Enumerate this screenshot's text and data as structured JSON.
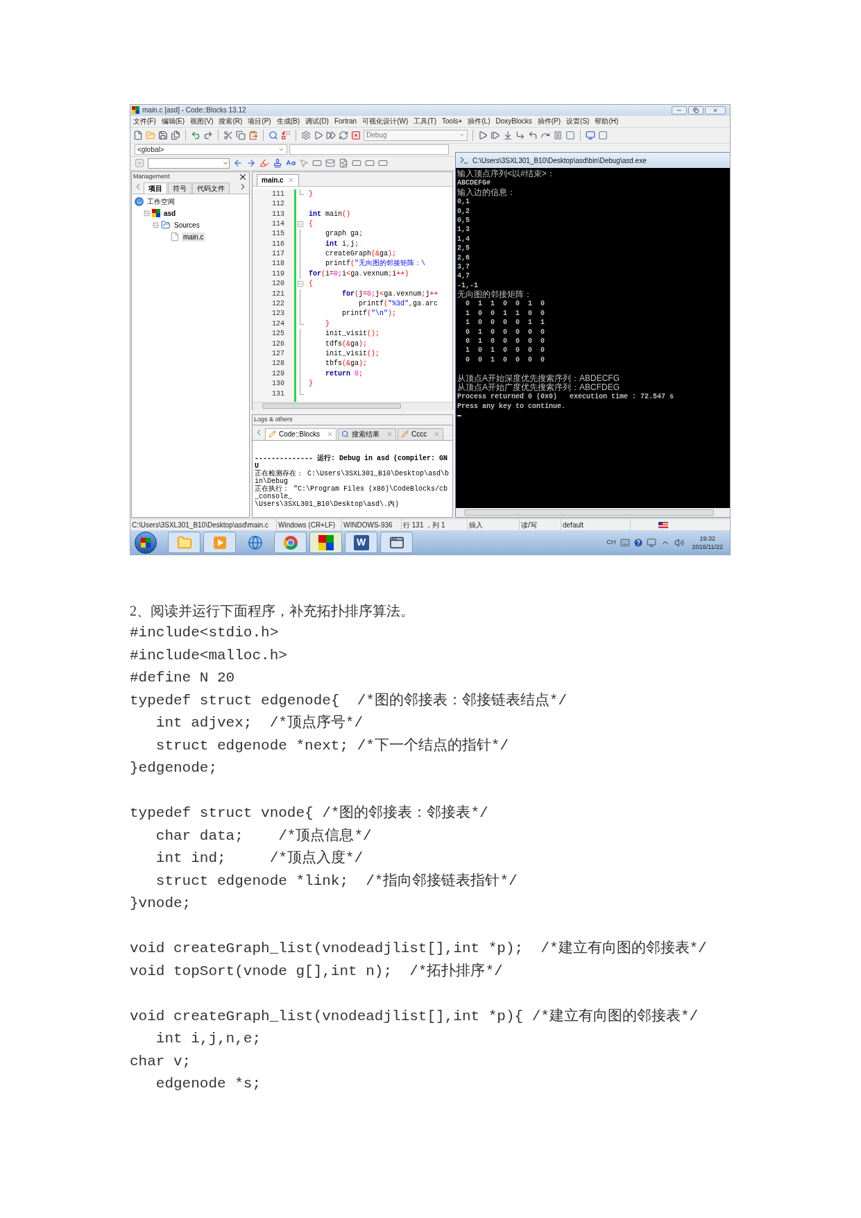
{
  "ide": {
    "title": "main.c [asd] - Code::Blocks 13.12",
    "menu": [
      "文件(F)",
      "编辑(E)",
      "视图(V)",
      "搜索(R)",
      "项目(P)",
      "生成(B)",
      "调试(D)",
      "Fortran",
      "可视化设计(W)",
      "工具(T)",
      "Tools+",
      "插件(L)",
      "DoxyBlocks",
      "插件(P)",
      "设置(S)",
      "帮助(H)"
    ],
    "build_target": "Debug",
    "scope": "<global>",
    "management": {
      "title": "Management",
      "tabs": [
        {
          "label": "项目",
          "selected": true
        },
        {
          "label": "符号",
          "selected": false
        },
        {
          "label": "代码文件",
          "selected": false
        }
      ],
      "tree": [
        {
          "label": "工作空间",
          "kind": "workspace",
          "selected": false,
          "children": [
            {
              "label": "asd",
              "kind": "project",
              "selected": false,
              "expanded": true,
              "children": [
                {
                  "label": "Sources",
                  "kind": "folder",
                  "selected": false,
                  "expanded": true,
                  "children": [
                    {
                      "label": "main.c",
                      "kind": "file",
                      "selected": true
                    }
                  ]
                }
              ]
            }
          ]
        }
      ]
    },
    "editor": {
      "tab": "main.c",
      "lines": [
        {
          "number": "111",
          "kind": "fold_end",
          "segments": [
            {
              "kind": "operator",
              "text": "}"
            }
          ]
        },
        {
          "number": "112",
          "kind": "plain"
        },
        {
          "number": "113",
          "kind": "plain",
          "segments": [
            {
              "kind": "keyword",
              "text": "int"
            },
            {
              "kind": "identifier",
              "text": " main"
            },
            {
              "kind": "operator",
              "text": "()"
            }
          ]
        },
        {
          "number": "114",
          "kind": "fold_start",
          "segments": [
            {
              "kind": "operator",
              "text": "{"
            }
          ]
        },
        {
          "number": "115",
          "kind": "fold_inside",
          "segments": [
            {
              "kind": "identifier",
              "text": "    graph ga"
            },
            {
              "kind": "operator",
              "text": ";"
            }
          ]
        },
        {
          "number": "116",
          "kind": "fold_inside",
          "segments": [
            {
              "kind": "keyword",
              "text": "    int"
            },
            {
              "kind": "identifier",
              "text": " i"
            },
            {
              "kind": "operator",
              "text": ","
            },
            {
              "kind": "identifier",
              "text": "j"
            },
            {
              "kind": "operator",
              "text": ";"
            }
          ]
        },
        {
          "number": "117",
          "kind": "fold_inside",
          "segments": [
            {
              "kind": "identifier",
              "text": "    createGraph"
            },
            {
              "kind": "operator",
              "text": "(&"
            },
            {
              "kind": "identifier",
              "text": "ga"
            },
            {
              "kind": "operator",
              "text": ");"
            }
          ]
        },
        {
          "number": "118",
          "kind": "fold_inside",
          "segments": [
            {
              "kind": "identifier",
              "text": "    printf"
            },
            {
              "kind": "operator",
              "text": "("
            },
            {
              "kind": "string",
              "text": "\"无向图的邻接矩阵：\\"
            }
          ]
        },
        {
          "number": "119",
          "kind": "fold_inside",
          "segments": [
            {
              "kind": "keyword",
              "text": "for"
            },
            {
              "kind": "operator",
              "text": "("
            },
            {
              "kind": "identifier",
              "text": "i"
            },
            {
              "kind": "operator",
              "text": "="
            },
            {
              "kind": "number",
              "text": "0"
            },
            {
              "kind": "operator",
              "text": ";"
            },
            {
              "kind": "identifier",
              "text": "i"
            },
            {
              "kind": "operator",
              "text": "<"
            },
            {
              "kind": "identifier",
              "text": "ga"
            },
            {
              "kind": "operator",
              "text": "."
            },
            {
              "kind": "identifier",
              "text": "vexnum"
            },
            {
              "kind": "operator",
              "text": ";"
            },
            {
              "kind": "identifier",
              "text": "i"
            },
            {
              "kind": "operator",
              "text": "++)"
            }
          ]
        },
        {
          "number": "120",
          "kind": "fold_start",
          "segments": [
            {
              "kind": "operator",
              "text": "{"
            }
          ]
        },
        {
          "number": "121",
          "kind": "fold_inside",
          "segments": [
            {
              "kind": "keyword",
              "text": "        for"
            },
            {
              "kind": "operator",
              "text": "("
            },
            {
              "kind": "identifier",
              "text": "j"
            },
            {
              "kind": "operator",
              "text": "="
            },
            {
              "kind": "number",
              "text": "0"
            },
            {
              "kind": "operator",
              "text": ";"
            },
            {
              "kind": "identifier",
              "text": "j"
            },
            {
              "kind": "operator",
              "text": "<"
            },
            {
              "kind": "identifier",
              "text": "ga"
            },
            {
              "kind": "operator",
              "text": "."
            },
            {
              "kind": "identifier",
              "text": "vexnum"
            },
            {
              "kind": "operator",
              "text": ";"
            },
            {
              "kind": "identifier",
              "text": "j"
            },
            {
              "kind": "operator",
              "text": "++"
            }
          ]
        },
        {
          "number": "122",
          "kind": "fold_inside",
          "segments": [
            {
              "kind": "identifier",
              "text": "            printf"
            },
            {
              "kind": "operator",
              "text": "("
            },
            {
              "kind": "string",
              "text": "\"%3d\""
            },
            {
              "kind": "operator",
              "text": ","
            },
            {
              "kind": "identifier",
              "text": "ga"
            },
            {
              "kind": "operator",
              "text": "."
            },
            {
              "kind": "identifier",
              "text": "arc"
            }
          ]
        },
        {
          "number": "123",
          "kind": "fold_inside",
          "segments": [
            {
              "kind": "identifier",
              "text": "        printf"
            },
            {
              "kind": "operator",
              "text": "("
            },
            {
              "kind": "string",
              "text": "\"\\n\""
            },
            {
              "kind": "operator",
              "text": ");"
            }
          ]
        },
        {
          "number": "124",
          "kind": "fold_end",
          "segments": [
            {
              "kind": "operator",
              "text": "    }"
            }
          ]
        },
        {
          "number": "125",
          "kind": "fold_inside",
          "segments": [
            {
              "kind": "identifier",
              "text": "    init_visit"
            },
            {
              "kind": "operator",
              "text": "();"
            }
          ]
        },
        {
          "number": "126",
          "kind": "fold_inside",
          "segments": [
            {
              "kind": "identifier",
              "text": "    tdfs"
            },
            {
              "kind": "operator",
              "text": "(&"
            },
            {
              "kind": "identifier",
              "text": "ga"
            },
            {
              "kind": "operator",
              "text": ");"
            }
          ]
        },
        {
          "number": "127",
          "kind": "fold_inside",
          "segments": [
            {
              "kind": "identifier",
              "text": "    init_visit"
            },
            {
              "kind": "operator",
              "text": "();"
            }
          ]
        },
        {
          "number": "128",
          "kind": "fold_inside",
          "segments": [
            {
              "kind": "identifier",
              "text": "    tbfs"
            },
            {
              "kind": "operator",
              "text": "(&"
            },
            {
              "kind": "identifier",
              "text": "ga"
            },
            {
              "kind": "operator",
              "text": ");"
            }
          ]
        },
        {
          "number": "129",
          "kind": "fold_inside",
          "segments": [
            {
              "kind": "keyword",
              "text": "    return "
            },
            {
              "kind": "number",
              "text": "0"
            },
            {
              "kind": "operator",
              "text": ";"
            }
          ]
        },
        {
          "number": "130",
          "kind": "fold_inside",
          "segments": [
            {
              "kind": "operator",
              "text": "}"
            }
          ]
        },
        {
          "number": "131",
          "kind": "fold_end"
        }
      ]
    },
    "logs": {
      "title": "Logs & others",
      "tabs": [
        {
          "label": "Code::Blocks",
          "kind": "log",
          "selected": true
        },
        {
          "label": "搜索结果",
          "kind": "search",
          "selected": false
        },
        {
          "label": "Cccc",
          "kind": "log",
          "selected": false
        }
      ],
      "lines": [
        {
          "kind": "header",
          "text": "-------------- 运行: Debug in asd (compiler: GNU"
        },
        {
          "kind": "info",
          "text": "正在检测存在： C:\\Users\\3SXL301_B10\\Desktop\\asd\\bin\\Debug"
        },
        {
          "kind": "info",
          "text": "正在执行： \"C:\\Program Files (x86)\\CodeBlocks/cb_console_"
        },
        {
          "kind": "info",
          "text": "\\Users\\3SXL301_B10\\Desktop\\asd\\.内)"
        }
      ]
    },
    "status_bar": [
      "C:\\Users\\3SXL301_B10\\Desktop\\asd\\main.c",
      "Windows (CR+LF)",
      "WINDOWS-936",
      "行 131 ，列 1",
      "插入",
      "读/写",
      "default"
    ]
  },
  "console": {
    "title": "C:\\Users\\3SXL301_B10\\Desktop\\asd\\bin\\Debug\\asd.exe",
    "sections": [
      {
        "lines": [
          {
            "kind": "prompt",
            "text": "输入顶点序列<以#结束>："
          },
          {
            "kind": "echo",
            "text": "ABCDEFG#"
          },
          {
            "kind": "prompt",
            "text": "输入边的信息："
          },
          {
            "kind": "echo",
            "text": "0,1"
          },
          {
            "kind": "echo",
            "text": "0,2"
          },
          {
            "kind": "echo",
            "text": "0,5"
          },
          {
            "kind": "echo",
            "text": "1,3"
          },
          {
            "kind": "echo",
            "text": "1,4"
          },
          {
            "kind": "echo",
            "text": "2,5"
          },
          {
            "kind": "echo",
            "text": "2,6"
          },
          {
            "kind": "echo",
            "text": "3,7"
          },
          {
            "kind": "echo",
            "text": "4,7"
          },
          {
            "kind": "echo",
            "text": "-1,-1"
          },
          {
            "kind": "prompt",
            "text": "无向图的邻接矩阵："
          },
          {
            "kind": "echo",
            "text": "  0  1  1  0  0  1  0"
          },
          {
            "kind": "echo",
            "text": "  1  0  0  1  1  0  0"
          },
          {
            "kind": "echo",
            "text": "  1  0  0  0  0  1  1"
          },
          {
            "kind": "echo",
            "text": "  0  1  0  0  0  0  0"
          },
          {
            "kind": "echo",
            "text": "  0  1  0  0  0  0  0"
          },
          {
            "kind": "echo",
            "text": "  1  0  1  0  0  0  0"
          },
          {
            "kind": "echo",
            "text": "  0  0  1  0  0  0  0"
          }
        ]
      },
      {
        "lines": [
          {
            "kind": "prompt",
            "text": "从顶点A开始深度优先搜索序列：ABDECFG"
          },
          {
            "kind": "prompt",
            "text": "从顶点A开始广度优先搜索序列：ABCFDEG"
          },
          {
            "kind": "echo",
            "text": "Process returned 0 (0x0)   execution time : 72.547 s"
          },
          {
            "kind": "echo",
            "text": "Press any key to continue."
          }
        ]
      }
    ]
  },
  "taskbar": {
    "apps": [
      {
        "kind": "folder",
        "running": true,
        "selected": false
      },
      {
        "kind": "media",
        "running": true,
        "selected": false
      },
      {
        "kind": "globe",
        "running": false,
        "selected": false
      },
      {
        "kind": "ring",
        "running": true,
        "selected": false
      },
      {
        "kind": "squares",
        "running": true,
        "selected": true
      },
      {
        "kind": "letter",
        "badge": "W",
        "running": true,
        "selected": false
      },
      {
        "kind": "window",
        "running": true,
        "selected": false
      }
    ],
    "language": "CH",
    "time": "19:32",
    "date": "2016/11/22"
  },
  "document": {
    "heading": "2、阅读并运行下面程序，补充拓扑排序算法。",
    "blocks": [
      {
        "lines": [
          "#include<stdio.h>",
          "#include<malloc.h>",
          "#define N 20",
          "typedef struct edgenode{  /*图的邻接表：邻接链表结点*/",
          "   int adjvex;  /*顶点序号*/",
          "   struct edgenode *next; /*下一个结点的指针*/",
          "}edgenode;"
        ]
      },
      {
        "lines": [
          "typedef struct vnode{ /*图的邻接表：邻接表*/",
          "   char data;    /*顶点信息*/",
          "   int ind;     /*顶点入度*/",
          "   struct edgenode *link;  /*指向邻接链表指针*/",
          "}vnode;"
        ]
      },
      {
        "lines": [
          "void createGraph_list(vnodeadjlist[],int *p);  /*建立有向图的邻接表*/",
          "void topSort(vnode g[],int n);  /*拓扑排序*/"
        ]
      },
      {
        "lines": [
          "void createGraph_list(vnodeadjlist[],int *p){ /*建立有向图的邻接表*/",
          "   int i,j,n,e;",
          "char v;",
          "   edgenode *s;"
        ]
      }
    ]
  }
}
